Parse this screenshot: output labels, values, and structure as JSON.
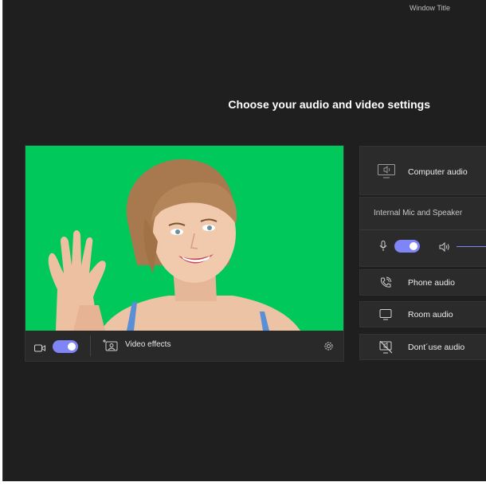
{
  "window": {
    "title": "Window Title"
  },
  "page": {
    "heading": "Choose your audio and video settings"
  },
  "video": {
    "camera_on": true,
    "effects_label": "Video effects"
  },
  "audio": {
    "options": {
      "computer": "Computer audio",
      "phone": "Phone audio",
      "room": "Room audio",
      "none": "Dont´use audio"
    },
    "device_label": "Internal Mic and Speaker",
    "mic_on": true
  },
  "colors": {
    "accent": "#7f85f5",
    "green_screen": "#00c85a",
    "background": "#1f1f1f"
  },
  "icons": {
    "camera": "video-camera-icon",
    "effects": "video-effects-icon",
    "settings": "gear-icon",
    "computer": "computer-speaker-icon",
    "mic": "microphone-icon",
    "speaker": "speaker-icon",
    "phone": "phone-icon",
    "room": "room-display-icon",
    "none": "no-audio-icon"
  }
}
